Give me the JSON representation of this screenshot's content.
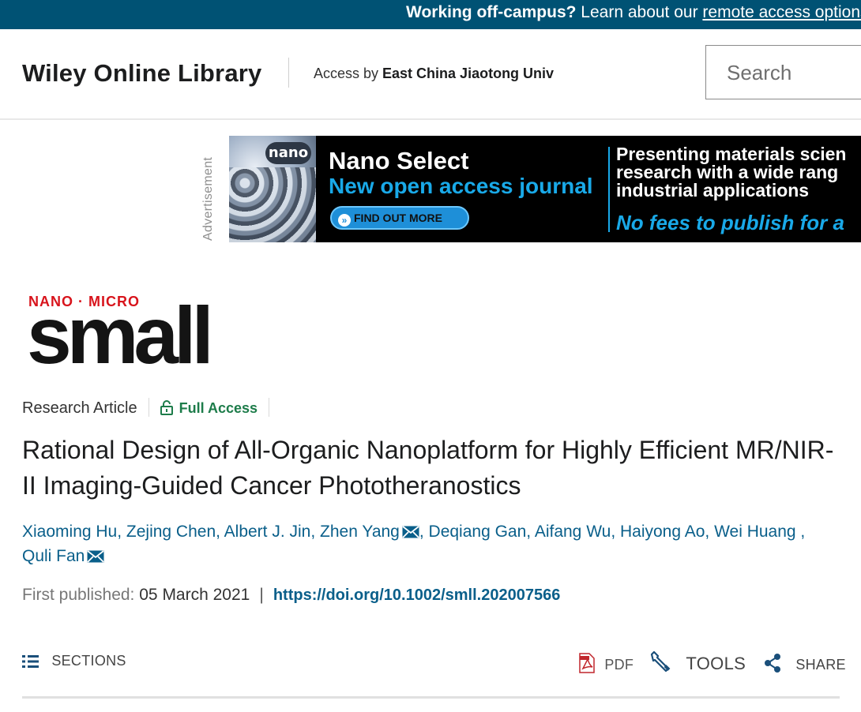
{
  "banner": {
    "bold": "Working off-campus?",
    "text": " Learn about our ",
    "link": "remote access options"
  },
  "header": {
    "logo": "Wiley Online Library",
    "access_label": "Access by",
    "institution": "East China Jiaotong Univ",
    "search_placeholder": "Search"
  },
  "ad": {
    "label": "Advertisement",
    "badge": "nano",
    "title": "Nano Select",
    "subtitle": "New open access journal",
    "button": "FIND OUT MORE",
    "right_lines": "Presenting materials science research with a wide range industrial applications",
    "right_line1": "Presenting materials scien",
    "right_line2": "research with a wide rang",
    "right_line3": "industrial applications",
    "tagline": "No fees to publish for a"
  },
  "journal": {
    "top": "NANO · MICRO",
    "word": "small"
  },
  "article": {
    "type": "Research Article",
    "access": "Full Access",
    "title": "Rational Design of All-Organic Nanoplatform for Highly Efficient MR/NIR-II Imaging-Guided Cancer Phototheranostics",
    "authors": [
      {
        "name": "Xiaoming Hu",
        "email": false
      },
      {
        "name": "Zejing Chen",
        "email": false
      },
      {
        "name": "Albert J. Jin",
        "email": false
      },
      {
        "name": "Zhen Yang",
        "email": true
      },
      {
        "name": "Deqiang Gan",
        "email": false
      },
      {
        "name": "Aifang Wu",
        "email": false
      },
      {
        "name": "Haiyong Ao",
        "email": false
      },
      {
        "name": "Wei Huang",
        "email": false
      },
      {
        "name": "Quli Fan",
        "email": true
      }
    ],
    "first_published_label": "First published:",
    "first_published_date": "05 March 2021",
    "separator": "|",
    "doi": "https://doi.org/10.1002/smll.202007566"
  },
  "toolbar": {
    "sections": "SECTIONS",
    "pdf": "PDF",
    "tools": "TOOLS",
    "share": "SHARE"
  }
}
